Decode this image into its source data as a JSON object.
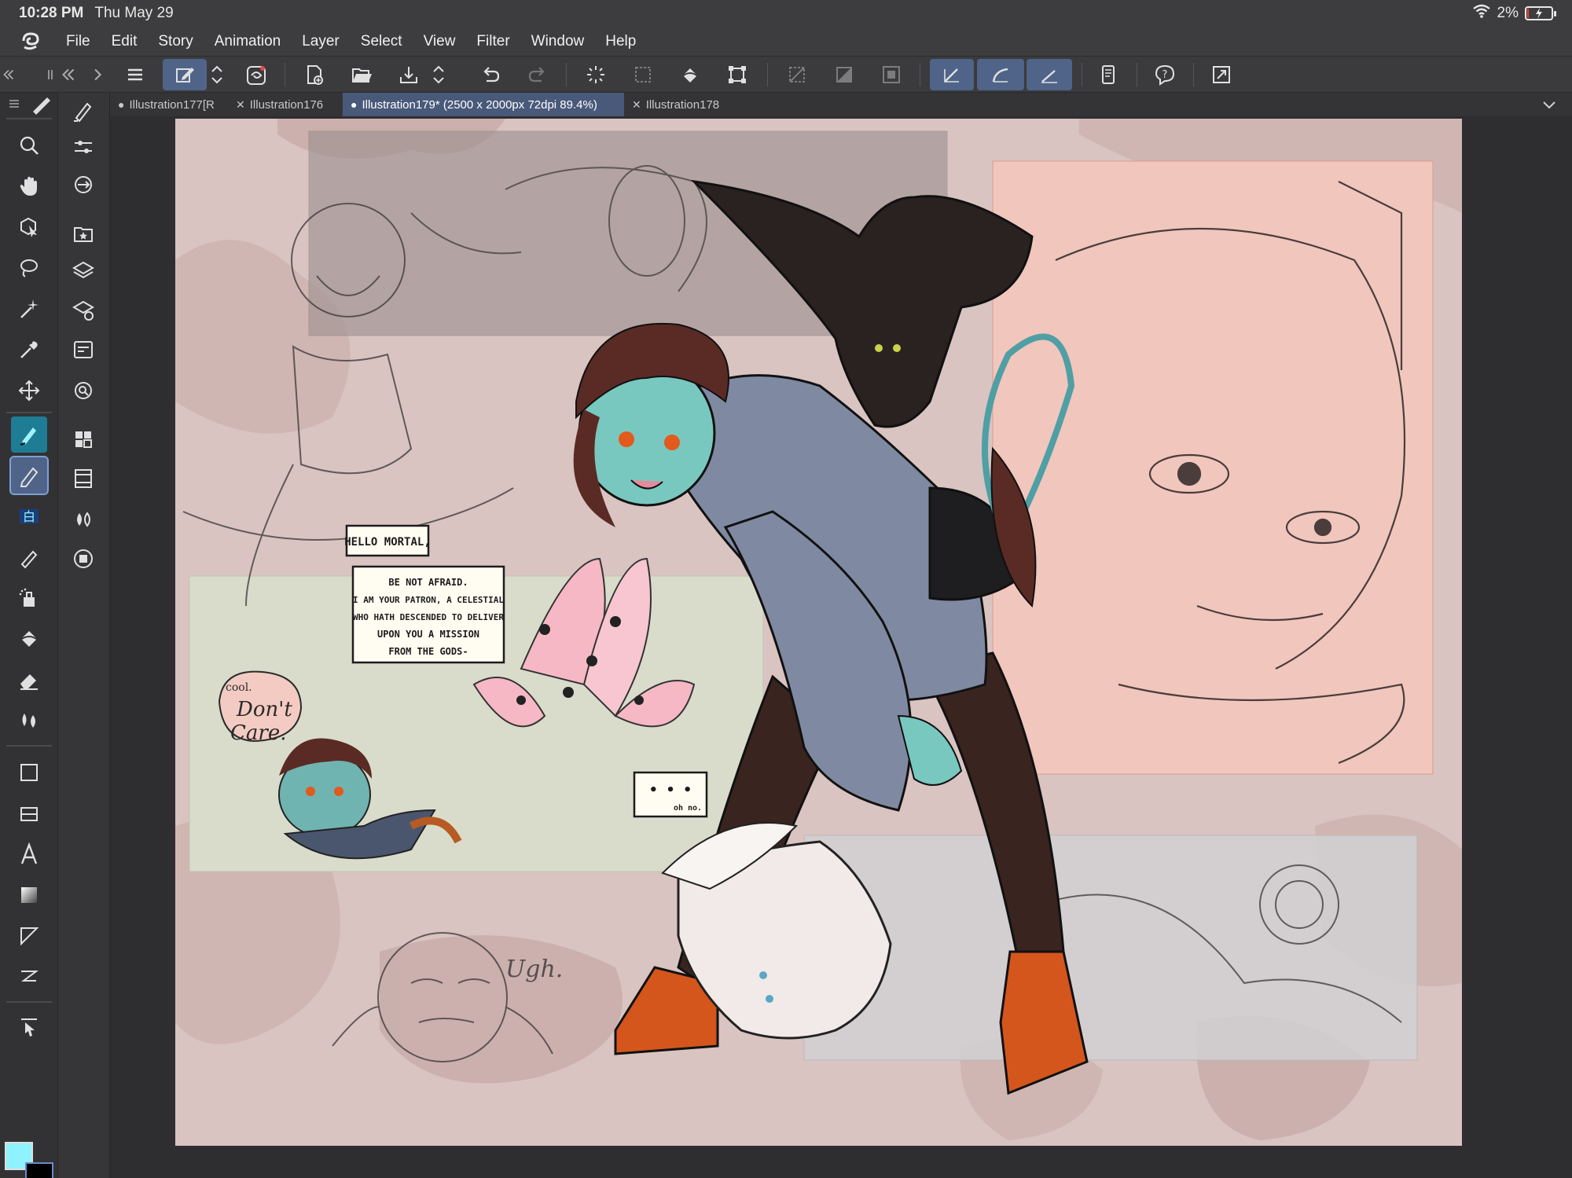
{
  "status": {
    "time": "10:28 PM",
    "date": "Thu May 29",
    "battery": "2%",
    "battery_level": 0.02,
    "battery_color": "#ff3b30"
  },
  "menu": [
    "File",
    "Edit",
    "Story",
    "Animation",
    "Layer",
    "Select",
    "View",
    "Filter",
    "Window",
    "Help"
  ],
  "tabs": [
    {
      "label": "Illustration177[R",
      "marker": "●",
      "active": false
    },
    {
      "label": "Illustration176",
      "marker": "✕",
      "active": false
    },
    {
      "label": "Illustration179* (2500 x 2000px 72dpi 89.4%)",
      "marker": "●",
      "active": true
    },
    {
      "label": "Illustration178",
      "marker": "✕",
      "active": false
    }
  ],
  "colors": {
    "accent": "#4f6488",
    "foreground_color": "#8ff3ff",
    "background_color": "#000000"
  },
  "artwork": {
    "bubble1": "HELLO MORTAL,",
    "bubble2": [
      "BE NOT AFRAID.",
      "I AM YOUR PATRON, A CELESTIAL",
      "WHO HATH DESCENDED TO DELIVER",
      "UPON YOU A MISSION",
      "FROM THE GODS-"
    ],
    "bubble3_dots": "• • •",
    "bubble3_small": "oh no.",
    "bubble4_small": "cool.",
    "bubble4_line1": "Don't",
    "bubble4_line2": "Care.",
    "sketch_text": "Ugh."
  }
}
